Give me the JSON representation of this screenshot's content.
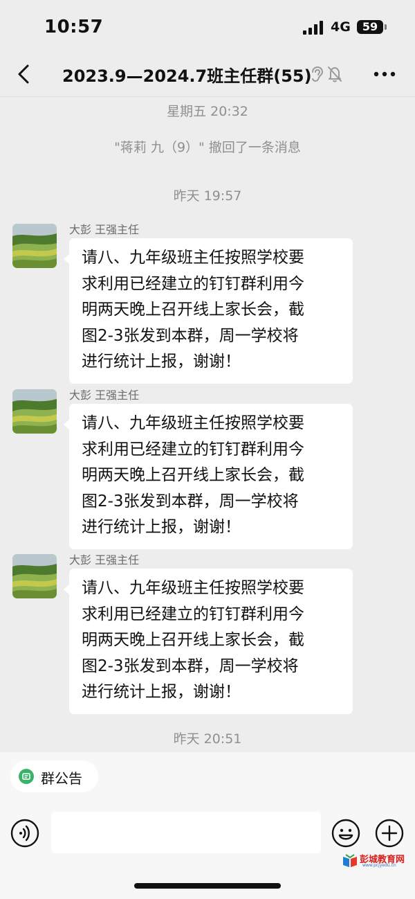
{
  "status_bar": {
    "time": "10:57",
    "network": "4G",
    "battery": "59"
  },
  "nav": {
    "title": "2023.9—2024.7班主任群(55)"
  },
  "chat": {
    "system_messages": [
      "星期五 20:32",
      "\"蒋莉 九（9）\" 撤回了一条消息",
      "昨天 19:57",
      "昨天 20:51"
    ],
    "messages": [
      {
        "sender": "大彭 王强主任",
        "lines": [
          "请八、九年级班主任按照学校要",
          "求利用已经建立的钉钉群利用今",
          "明两天晚上召开线上家长会，截",
          "图2-3张发到本群，周一学校将",
          "进行统计上报，谢谢！"
        ]
      },
      {
        "sender": "大彭 王强主任",
        "lines": [
          "请八、九年级班主任按照学校要",
          "求利用已经建立的钉钉群利用今",
          "明两天晚上召开线上家长会，截",
          "图2-3张发到本群，周一学校将",
          "进行统计上报，谢谢！"
        ]
      },
      {
        "sender": "大彭 王强主任",
        "lines": [
          "请八、九年级班主任按照学校要",
          "求利用已经建立的钉钉群利用今",
          "明两天晚上召开线上家长会，截",
          "图2-3张发到本群，周一学校将",
          "进行统计上报，谢谢！"
        ]
      }
    ]
  },
  "bottom": {
    "notice_label": "群公告",
    "input_value": ""
  },
  "watermark": {
    "text": "彭城教育网",
    "url": "www.pcjyedu.cn"
  },
  "icons": {
    "back": "back-chevron-icon",
    "ear": "earpiece-mode-icon",
    "mute": "mute-bell-icon",
    "more": "more-dots-icon",
    "notice": "notice-icon",
    "voice": "voice-icon",
    "emoji": "emoji-icon",
    "plus": "plus-icon"
  },
  "colors": {
    "background": "#ededed",
    "bubble": "#ffffff",
    "notice_green": "#3ab26a",
    "watermark_red": "#d8201c"
  }
}
